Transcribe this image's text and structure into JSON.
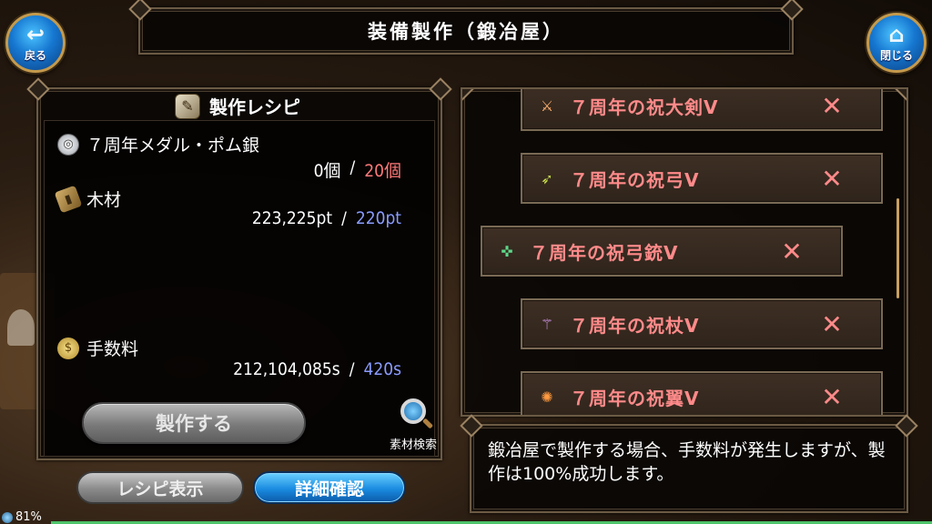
{
  "header": {
    "title": "装備製作（鍛冶屋）",
    "back_label": "戻る",
    "close_label": "閉じる"
  },
  "recipe": {
    "title": "製作レシピ",
    "materials": [
      {
        "name": "７周年メダル・ポム銀",
        "icon": "medal-icon",
        "owned": "0個",
        "required": "20個"
      },
      {
        "name": "木材",
        "icon": "wood-icon",
        "owned": "223,225pt",
        "required": "220pt"
      }
    ],
    "fee": {
      "name": "手数料",
      "icon": "coin-icon",
      "owned": "212,104,085s",
      "required": "420s"
    },
    "separator": "/",
    "make_button": "製作する",
    "search_label": "素材検索"
  },
  "bottom_buttons": {
    "recipe_view": "レシピ表示",
    "detail": "詳細確認"
  },
  "items": [
    {
      "name": "７周年の祝大剣Ⅴ",
      "icon": "greatsword-icon"
    },
    {
      "name": "７周年の祝弓Ⅴ",
      "icon": "bow-icon"
    },
    {
      "name": "７周年の祝弓銃Ⅴ",
      "icon": "crossbow-icon"
    },
    {
      "name": "７周年の祝杖Ⅴ",
      "icon": "staff-icon"
    },
    {
      "name": "７周年の祝翼Ⅴ",
      "icon": "wing-icon"
    }
  ],
  "unavailable_mark": "✕",
  "info": "鍛冶屋で製作する場合、手数料が発生しますが、製作は100%成功します。",
  "status": {
    "battery": "81%"
  },
  "colors": {
    "insufficient": "#ff7a7a",
    "required_ok": "#8a9cff",
    "item_text": "#ff8a8a",
    "accent_blue": "#1a8be0"
  }
}
